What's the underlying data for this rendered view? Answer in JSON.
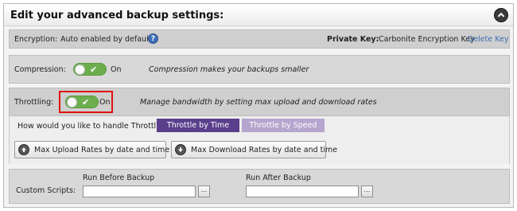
{
  "header": {
    "title": "Edit your advanced backup settings:",
    "collapse_icon": "chevron-up-icon"
  },
  "encryption": {
    "label": "Encryption:",
    "value": "Auto enabled by default",
    "help_glyph": "?",
    "private_key_label": "Private Key:",
    "private_key_value": "Carbonite Encryption Key",
    "delete_link": "Delete Key"
  },
  "compression": {
    "label": "Compression:",
    "toggle_state": "On",
    "description": "Compression makes your backups smaller"
  },
  "throttling": {
    "label": "Throttling:",
    "toggle_state": "On",
    "description": "Manage bandwidth by setting max upload and download rates",
    "question": "How would you like to handle Throttling?",
    "options": [
      "Throttle by Time",
      "Throttle by Speed"
    ],
    "selected_option": "Throttle by Time",
    "upload_button": "Max Upload Rates by date and time",
    "download_button": "Max Download Rates by date and time"
  },
  "scripts": {
    "label": "Custom Scripts:",
    "before_label": "Run Before Backup",
    "after_label": "Run After Backup",
    "before_value": "",
    "after_value": "",
    "browse_glyph": "..."
  },
  "colors": {
    "toggle_on": "#6cae4e",
    "selected_option": "#5a3f8c",
    "unselected_option": "#b6a5cf",
    "highlight": "#e01010",
    "link": "#3b6bb3"
  }
}
